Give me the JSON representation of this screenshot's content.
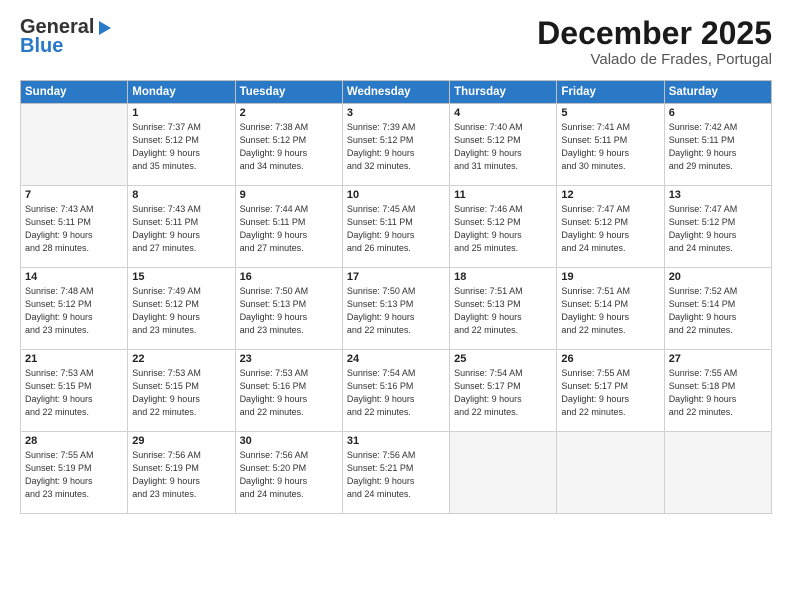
{
  "header": {
    "logo_line1": "General",
    "logo_line2": "Blue",
    "month_title": "December 2025",
    "location": "Valado de Frades, Portugal"
  },
  "weekdays": [
    "Sunday",
    "Monday",
    "Tuesday",
    "Wednesday",
    "Thursday",
    "Friday",
    "Saturday"
  ],
  "weeks": [
    [
      {
        "day": "",
        "empty": true
      },
      {
        "day": "1",
        "sunrise": "7:37 AM",
        "sunset": "5:12 PM",
        "daylight": "9 hours and 35 minutes."
      },
      {
        "day": "2",
        "sunrise": "7:38 AM",
        "sunset": "5:12 PM",
        "daylight": "9 hours and 34 minutes."
      },
      {
        "day": "3",
        "sunrise": "7:39 AM",
        "sunset": "5:12 PM",
        "daylight": "9 hours and 32 minutes."
      },
      {
        "day": "4",
        "sunrise": "7:40 AM",
        "sunset": "5:12 PM",
        "daylight": "9 hours and 31 minutes."
      },
      {
        "day": "5",
        "sunrise": "7:41 AM",
        "sunset": "5:11 PM",
        "daylight": "9 hours and 30 minutes."
      },
      {
        "day": "6",
        "sunrise": "7:42 AM",
        "sunset": "5:11 PM",
        "daylight": "9 hours and 29 minutes."
      }
    ],
    [
      {
        "day": "7",
        "sunrise": "7:43 AM",
        "sunset": "5:11 PM",
        "daylight": "9 hours and 28 minutes."
      },
      {
        "day": "8",
        "sunrise": "7:43 AM",
        "sunset": "5:11 PM",
        "daylight": "9 hours and 27 minutes."
      },
      {
        "day": "9",
        "sunrise": "7:44 AM",
        "sunset": "5:11 PM",
        "daylight": "9 hours and 27 minutes."
      },
      {
        "day": "10",
        "sunrise": "7:45 AM",
        "sunset": "5:11 PM",
        "daylight": "9 hours and 26 minutes."
      },
      {
        "day": "11",
        "sunrise": "7:46 AM",
        "sunset": "5:12 PM",
        "daylight": "9 hours and 25 minutes."
      },
      {
        "day": "12",
        "sunrise": "7:47 AM",
        "sunset": "5:12 PM",
        "daylight": "9 hours and 24 minutes."
      },
      {
        "day": "13",
        "sunrise": "7:47 AM",
        "sunset": "5:12 PM",
        "daylight": "9 hours and 24 minutes."
      }
    ],
    [
      {
        "day": "14",
        "sunrise": "7:48 AM",
        "sunset": "5:12 PM",
        "daylight": "9 hours and 23 minutes."
      },
      {
        "day": "15",
        "sunrise": "7:49 AM",
        "sunset": "5:12 PM",
        "daylight": "9 hours and 23 minutes."
      },
      {
        "day": "16",
        "sunrise": "7:50 AM",
        "sunset": "5:13 PM",
        "daylight": "9 hours and 23 minutes."
      },
      {
        "day": "17",
        "sunrise": "7:50 AM",
        "sunset": "5:13 PM",
        "daylight": "9 hours and 22 minutes."
      },
      {
        "day": "18",
        "sunrise": "7:51 AM",
        "sunset": "5:13 PM",
        "daylight": "9 hours and 22 minutes."
      },
      {
        "day": "19",
        "sunrise": "7:51 AM",
        "sunset": "5:14 PM",
        "daylight": "9 hours and 22 minutes."
      },
      {
        "day": "20",
        "sunrise": "7:52 AM",
        "sunset": "5:14 PM",
        "daylight": "9 hours and 22 minutes."
      }
    ],
    [
      {
        "day": "21",
        "sunrise": "7:53 AM",
        "sunset": "5:15 PM",
        "daylight": "9 hours and 22 minutes."
      },
      {
        "day": "22",
        "sunrise": "7:53 AM",
        "sunset": "5:15 PM",
        "daylight": "9 hours and 22 minutes."
      },
      {
        "day": "23",
        "sunrise": "7:53 AM",
        "sunset": "5:16 PM",
        "daylight": "9 hours and 22 minutes."
      },
      {
        "day": "24",
        "sunrise": "7:54 AM",
        "sunset": "5:16 PM",
        "daylight": "9 hours and 22 minutes."
      },
      {
        "day": "25",
        "sunrise": "7:54 AM",
        "sunset": "5:17 PM",
        "daylight": "9 hours and 22 minutes."
      },
      {
        "day": "26",
        "sunrise": "7:55 AM",
        "sunset": "5:17 PM",
        "daylight": "9 hours and 22 minutes."
      },
      {
        "day": "27",
        "sunrise": "7:55 AM",
        "sunset": "5:18 PM",
        "daylight": "9 hours and 22 minutes."
      }
    ],
    [
      {
        "day": "28",
        "sunrise": "7:55 AM",
        "sunset": "5:19 PM",
        "daylight": "9 hours and 23 minutes."
      },
      {
        "day": "29",
        "sunrise": "7:56 AM",
        "sunset": "5:19 PM",
        "daylight": "9 hours and 23 minutes."
      },
      {
        "day": "30",
        "sunrise": "7:56 AM",
        "sunset": "5:20 PM",
        "daylight": "9 hours and 24 minutes."
      },
      {
        "day": "31",
        "sunrise": "7:56 AM",
        "sunset": "5:21 PM",
        "daylight": "9 hours and 24 minutes."
      },
      {
        "day": "",
        "empty": true
      },
      {
        "day": "",
        "empty": true
      },
      {
        "day": "",
        "empty": true
      }
    ]
  ]
}
